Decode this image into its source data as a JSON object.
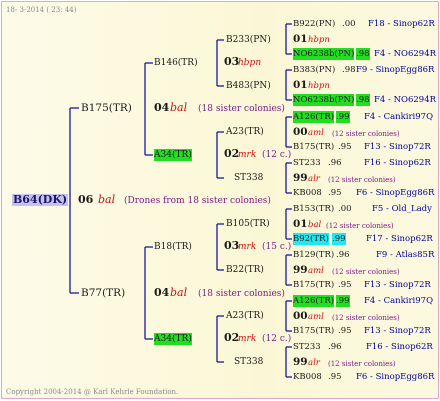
{
  "header": {
    "datestamp": "18-  3-2014 ( 23: 44)"
  },
  "footer": {
    "copyright": "Copyright 2004-2014 @ Karl Kehrle Foundation."
  },
  "colors": {
    "line": "#1a1a99",
    "green_highlight": "#22dd22",
    "cyan_highlight": "#22e6f0",
    "root_box": "#c6c2ea"
  },
  "root": {
    "id": "B64(DK)",
    "gen": "06",
    "race": "bal",
    "note": "(Drones from 18 sister colonies)"
  },
  "upper": {
    "id": "B175(TR)",
    "gen": "04",
    "race": "bal",
    "note": "(18 sister colonies)",
    "b146": {
      "id": "B146(TR)",
      "gen": "03",
      "race": "hbpn"
    },
    "a34": {
      "id": "A34(TR)",
      "gen": "02",
      "race": "mrk",
      "note": "(12 c.)"
    },
    "b233": "B233(PN)",
    "b483": "B483(PN)",
    "a23": "A23(TR)",
    "st338": "ST338",
    "r1": {
      "id": "B922(PN)",
      "yr": ".00",
      "code": "F18 - Sinop62R"
    },
    "r2": {
      "gen": "01",
      "race": "hbpn"
    },
    "r3": {
      "id": "NO6238b(PN)",
      "yr": ".98",
      "code": "F4 - NO6294R"
    },
    "r4": {
      "id": "B383(PN)",
      "yr": ".98",
      "code": "F9 - SinopEgg86R"
    },
    "r5": {
      "gen": "01",
      "race": "hbpn"
    },
    "r6": {
      "id": "NO6238b(PN)",
      "yr": ".98",
      "code": "F4 - NO6294R"
    },
    "r7": {
      "id": "A126(TR)",
      "yr": ".99",
      "code": "F4 - Cankiri97Q"
    },
    "r8": {
      "gen": "00",
      "race": "aml",
      "note": "(12 sister colonies)"
    },
    "r9": {
      "id": "B175(TR)",
      "yr": ".95",
      "code": "F13 - Sinop72R"
    },
    "r10": {
      "id": "ST233",
      "yr": ".96",
      "code": "F16 - Sinop62R"
    },
    "r11": {
      "gen": "99",
      "race": "alr",
      "note": "(12 sister colonies)"
    },
    "r12": {
      "id": "KB008",
      "yr": ".95",
      "code": "F6 - SinopEgg86R"
    }
  },
  "lower": {
    "id": "B77(TR)",
    "gen": "04",
    "race": "bal",
    "note": "(18 sister colonies)",
    "b18": {
      "id": "B18(TR)",
      "gen": "03",
      "race": "mrk",
      "note": "(15 c.)"
    },
    "a34": {
      "id": "A34(TR)",
      "gen": "02",
      "race": "mrk",
      "note": "(12 c.)"
    },
    "b105": "B105(TR)",
    "b22": "B22(TR)",
    "a23": "A23(TR)",
    "st338": "ST338",
    "r1": {
      "id": "B153(TR)",
      "yr": ".00",
      "code": "F5 - Old_Lady"
    },
    "r2": {
      "gen": "01",
      "race": "bal",
      "note": "(12 sister colonies)"
    },
    "r3": {
      "id": "B92(TR)",
      "yr": ".99",
      "code": "F17 - Sinop62R"
    },
    "r4": {
      "id": "B129(TR)",
      "yr": ".96",
      "code": "F9 - Atlas85R"
    },
    "r5": {
      "gen": "99",
      "race": "aml",
      "note": "(12 sister colonies)"
    },
    "r6": {
      "id": "B175(TR)",
      "yr": ".95",
      "code": "F13 - Sinop72R"
    },
    "r7": {
      "id": "A126(TR)",
      "yr": ".99",
      "code": "F4 - Cankiri97Q"
    },
    "r8": {
      "gen": "00",
      "race": "aml",
      "note": "(12 sister colonies)"
    },
    "r9": {
      "id": "B175(TR)",
      "yr": ".95",
      "code": "F13 - Sinop72R"
    },
    "r10": {
      "id": "ST233",
      "yr": ".96",
      "code": "F16 - Sinop62R"
    },
    "r11": {
      "gen": "99",
      "race": "alr",
      "note": "(12 sister colonies)"
    },
    "r12": {
      "id": "KB008",
      "yr": ".95",
      "code": "F6 - SinopEgg86R"
    }
  }
}
